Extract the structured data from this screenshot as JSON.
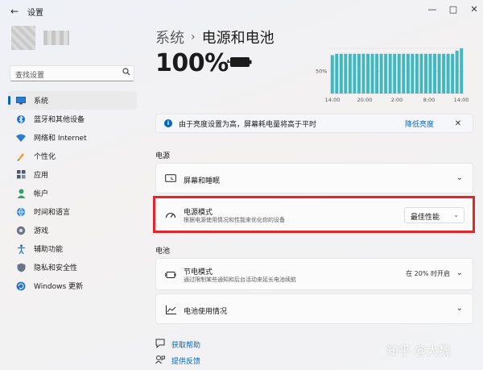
{
  "window": {
    "title": "设置",
    "back_icon": "back-arrow-icon",
    "controls": [
      "minimize",
      "maximize",
      "close"
    ]
  },
  "sidebar": {
    "search_placeholder": "查找设置",
    "items": [
      {
        "label": "系统",
        "icon": "monitor-icon",
        "active": true
      },
      {
        "label": "蓝牙和其他设备",
        "icon": "bluetooth-icon"
      },
      {
        "label": "网络和 Internet",
        "icon": "wifi-icon"
      },
      {
        "label": "个性化",
        "icon": "pen-icon"
      },
      {
        "label": "应用",
        "icon": "apps-icon"
      },
      {
        "label": "帐户",
        "icon": "account-icon"
      },
      {
        "label": "时间和语言",
        "icon": "globe-clock-icon"
      },
      {
        "label": "游戏",
        "icon": "gamepad-icon"
      },
      {
        "label": "辅助功能",
        "icon": "accessibility-icon"
      },
      {
        "label": "隐私和安全性",
        "icon": "shield-icon"
      },
      {
        "label": "Windows 更新",
        "icon": "update-icon"
      }
    ]
  },
  "header": {
    "parent": "系统",
    "separator": "›",
    "title": "电源和电池"
  },
  "battery": {
    "percent_label": "100%",
    "charging": true
  },
  "chart_data": {
    "type": "bar",
    "ylabel_tick": "50%",
    "x_ticks": [
      "14:00",
      "20:00",
      "2:00",
      "8:00",
      "14:00"
    ],
    "values": [
      85,
      88,
      88,
      88,
      88,
      88,
      88,
      88,
      88,
      88,
      88,
      88,
      88,
      88,
      88,
      88,
      88,
      88,
      88,
      88,
      88,
      88,
      88,
      88,
      88,
      88,
      88,
      88,
      95,
      100
    ],
    "ylim": [
      0,
      100
    ],
    "color": "#3fb8c0"
  },
  "info_bar": {
    "text": "由于亮度设置为高，屏幕耗电量将高于平时",
    "link": "降低亮度"
  },
  "sections": {
    "power": "电源",
    "battery": "电池"
  },
  "cards": {
    "screen_sleep": {
      "title": "屏幕和睡眠"
    },
    "power_mode": {
      "title": "电源模式",
      "subtitle": "根据电源使用情况和性能来优化你的设备",
      "value": "最佳性能"
    },
    "battery_saver": {
      "title": "节电模式",
      "subtitle": "通过限制某些通知和后台活动来延长电池续航",
      "status": "在 20% 时开启"
    },
    "battery_usage": {
      "title": "电池使用情况"
    }
  },
  "footer": {
    "help": "获取帮助",
    "feedback": "提供反馈"
  },
  "watermark": "知乎 @大魏"
}
